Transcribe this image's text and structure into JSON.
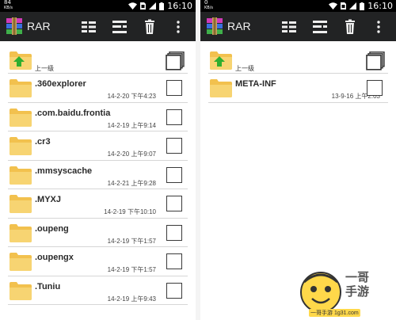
{
  "left": {
    "status": {
      "net_value": "84",
      "net_unit": "KB/s",
      "time": "16:10"
    },
    "app_title": "RAR",
    "up_label": "上一级",
    "items": [
      {
        "name": ".360explorer",
        "date": "14-2-20 下午4:23"
      },
      {
        "name": ".com.baidu.frontia",
        "date": "14-2-19 上午9:14"
      },
      {
        "name": ".cr3",
        "date": "14-2-20 上午9:07"
      },
      {
        "name": ".mmsyscache",
        "date": "14-2-21 上午9:28"
      },
      {
        "name": ".MYXJ",
        "date": "14-2-19 下午10:10"
      },
      {
        "name": ".oupeng",
        "date": "14-2-19 下午1:57"
      },
      {
        "name": ".oupengx",
        "date": "14-2-19 下午1:57"
      },
      {
        "name": ".Tuniu",
        "date": "14-2-19 上午9:43"
      }
    ]
  },
  "right": {
    "status": {
      "net_value": "0",
      "net_unit": "KB/s",
      "time": "16:10"
    },
    "app_title": "RAR",
    "up_label": "上一级",
    "items": [
      {
        "name": "META-INF",
        "date": "13-9-16 上午2:03"
      }
    ]
  },
  "watermark": {
    "brand": "一哥\n手游",
    "url": "一哥手游 1g31.com"
  },
  "colors": {
    "actionbar": "#222324",
    "statusbar": "#000000",
    "folder": "#f2c14e",
    "up_arrow": "#2fae2f"
  }
}
